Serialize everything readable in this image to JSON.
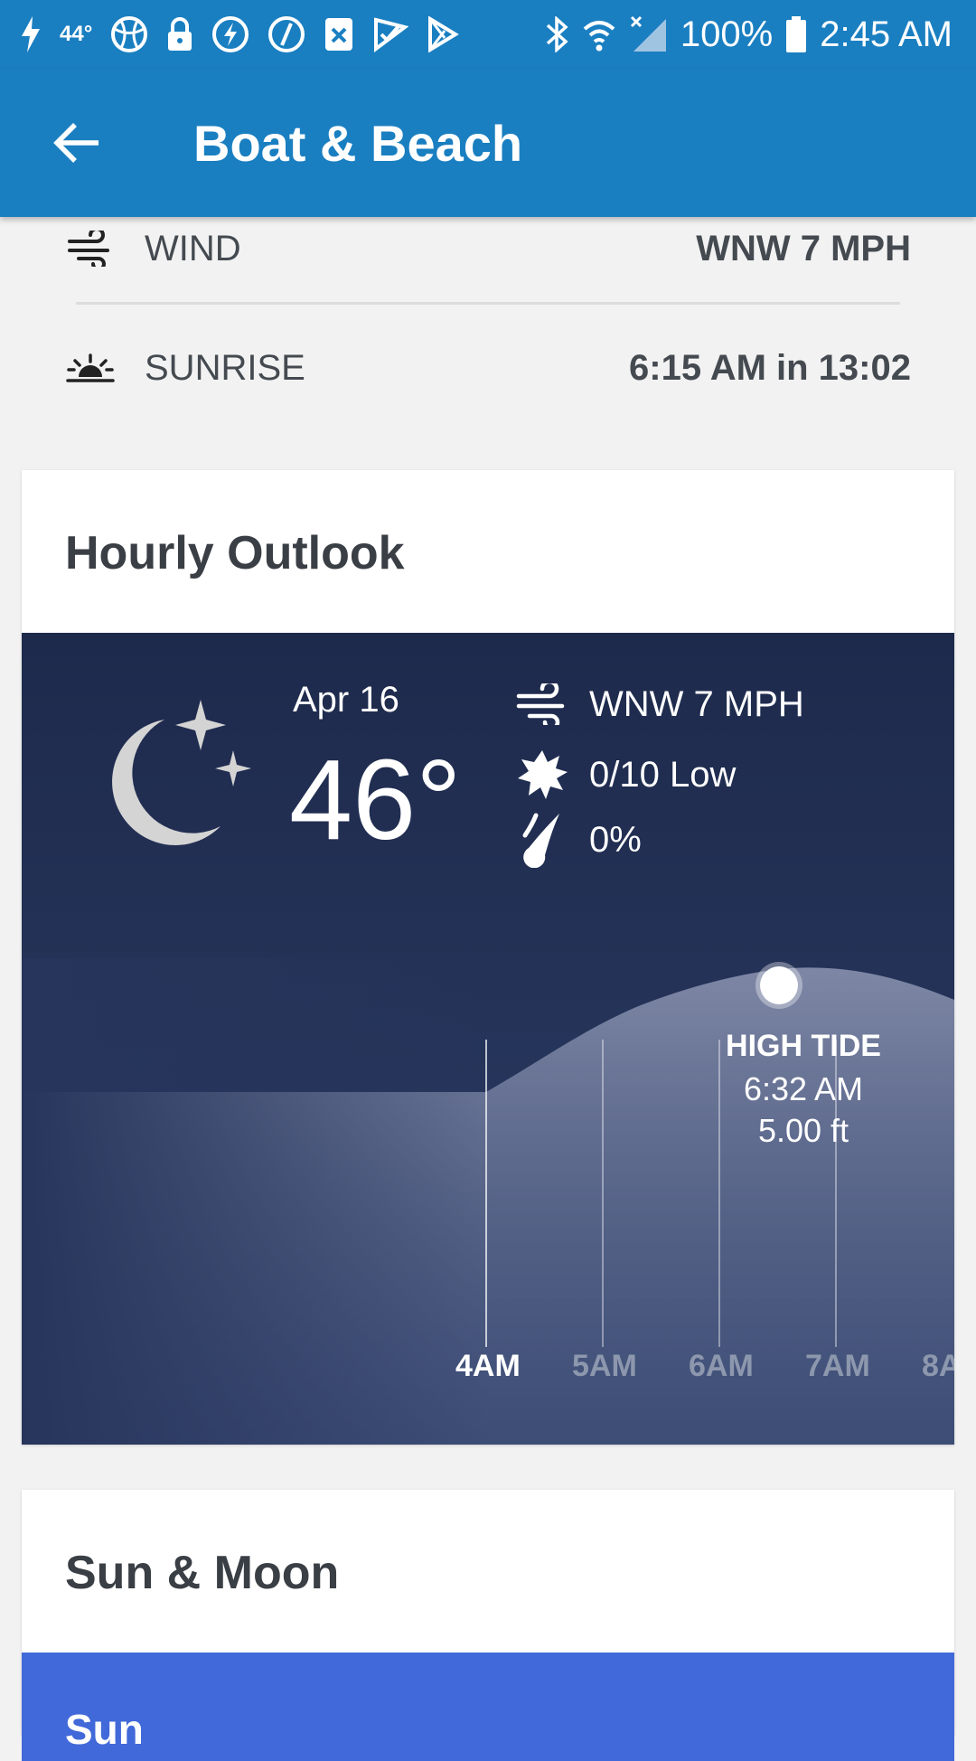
{
  "status_bar": {
    "temperature": "44°",
    "battery_percent": "100%",
    "time": "2:45 AM",
    "left_icons": [
      "flash-icon",
      "temperature-badge",
      "basketball-icon",
      "lock-icon",
      "bolt-circle-icon",
      "edge-circle-icon",
      "app-box-icon",
      "check-flag-icon",
      "play-store-icon"
    ],
    "right_icons": [
      "bluetooth-icon",
      "wifi-icon",
      "signal-icon",
      "battery-icon"
    ]
  },
  "app_bar": {
    "title": "Boat & Beach",
    "back_icon": "arrow-left-icon",
    "color": "#1a7fc1"
  },
  "conditions": {
    "wind": {
      "label": "WIND",
      "value": "WNW 7 MPH",
      "icon": "wind-icon"
    },
    "sunrise": {
      "label": "SUNRISE",
      "value": "6:15 AM in 13:02",
      "icon": "sunrise-icon"
    }
  },
  "hourly_outlook": {
    "title": "Hourly Outlook",
    "date": "Apr 16",
    "temperature": "46°",
    "condition_icon": "moon-stars-icon",
    "stats": [
      {
        "icon": "wind-icon",
        "text": "WNW 7 MPH"
      },
      {
        "icon": "sun-uv-icon",
        "text": "0/10 Low"
      },
      {
        "icon": "raindrop-icon",
        "text": "0%"
      }
    ],
    "tide": {
      "title": "HIGH TIDE",
      "time": "6:32 AM",
      "height": "5.00 ft"
    },
    "hours": [
      "4AM",
      "5AM",
      "6AM",
      "7AM",
      "8A"
    ],
    "selected_hour": "4AM",
    "panel_colors": [
      "#1e2a4c",
      "#2c3d67"
    ]
  },
  "sun_moon": {
    "title": "Sun & Moon",
    "tab_label": "Sun",
    "tab_color": "#4169d9"
  }
}
